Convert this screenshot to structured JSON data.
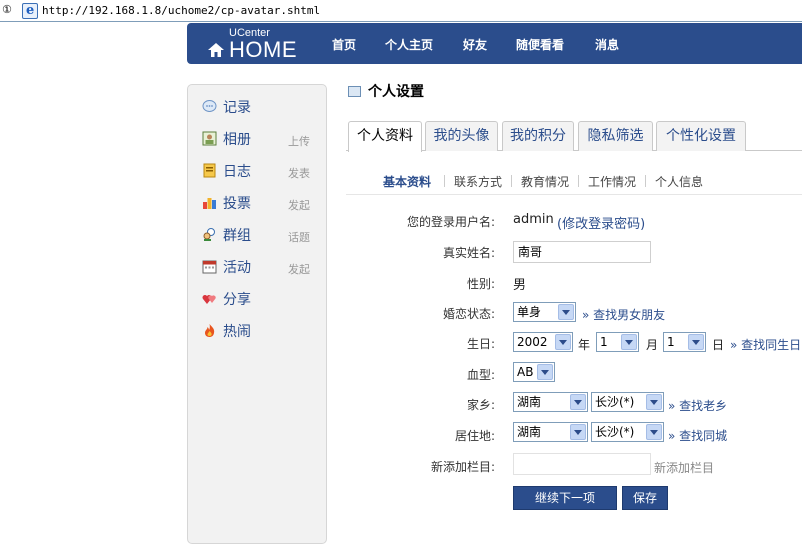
{
  "browser": {
    "address_label": "①",
    "url": "http://192.168.1.8/uchome2/cp-avatar.shtml"
  },
  "header": {
    "logo_small": "UCenter",
    "logo_big": "HOME",
    "nav": [
      "首页",
      "个人主页",
      "好友",
      "随便看看",
      "消息"
    ]
  },
  "sidebar": {
    "items": [
      {
        "label": "记录",
        "sub": "",
        "icon": "chat-bubble-icon"
      },
      {
        "label": "相册",
        "sub": "上传",
        "icon": "photo-icon"
      },
      {
        "label": "日志",
        "sub": "发表",
        "icon": "notebook-icon"
      },
      {
        "label": "投票",
        "sub": "发起",
        "icon": "bar-chart-icon"
      },
      {
        "label": "群组",
        "sub": "话题",
        "icon": "people-icon"
      },
      {
        "label": "活动",
        "sub": "发起",
        "icon": "calendar-icon"
      },
      {
        "label": "分享",
        "sub": "",
        "icon": "hearts-icon"
      },
      {
        "label": "热闹",
        "sub": "",
        "icon": "fire-icon"
      }
    ]
  },
  "page": {
    "title": "个人设置"
  },
  "tabs": [
    "个人资料",
    "我的头像",
    "我的积分",
    "隐私筛选",
    "个性化设置"
  ],
  "subtabs": [
    "基本资料",
    "联系方式",
    "教育情况",
    "工作情况",
    "个人信息"
  ],
  "form": {
    "username_label": "您的登录用户名:",
    "username_value": "admin",
    "change_password_link": "(修改登录密码)",
    "realname_label": "真实姓名:",
    "realname_value": "南哥",
    "gender_label": "性别:",
    "gender_value": "男",
    "marital_label": "婚恋状态:",
    "marital_value": "单身",
    "marital_link": "» 查找男女朋友",
    "birthday_label": "生日:",
    "birth_year": "2002",
    "year_unit": "年",
    "birth_month": "1",
    "month_unit": "月",
    "birth_day": "1",
    "day_unit": "日",
    "birthday_link": "» 查找同生日",
    "blood_label": "血型:",
    "blood_value": "AB",
    "hometown_label": "家乡:",
    "hometown_province": "湖南",
    "hometown_city": "长沙(*)",
    "hometown_link": "» 查找老乡",
    "residence_label": "居住地:",
    "residence_province": "湖南",
    "residence_city": "长沙(*)",
    "residence_link": "» 查找同城",
    "newfield_label": "新添加栏目:",
    "newfield_value": "",
    "newfield_hint": "新添加栏目",
    "continue_button": "继续下一项",
    "save_button": "保存"
  },
  "colors": {
    "brand": "#2b4d8c",
    "sidebar_bg": "#f2f2f2"
  }
}
